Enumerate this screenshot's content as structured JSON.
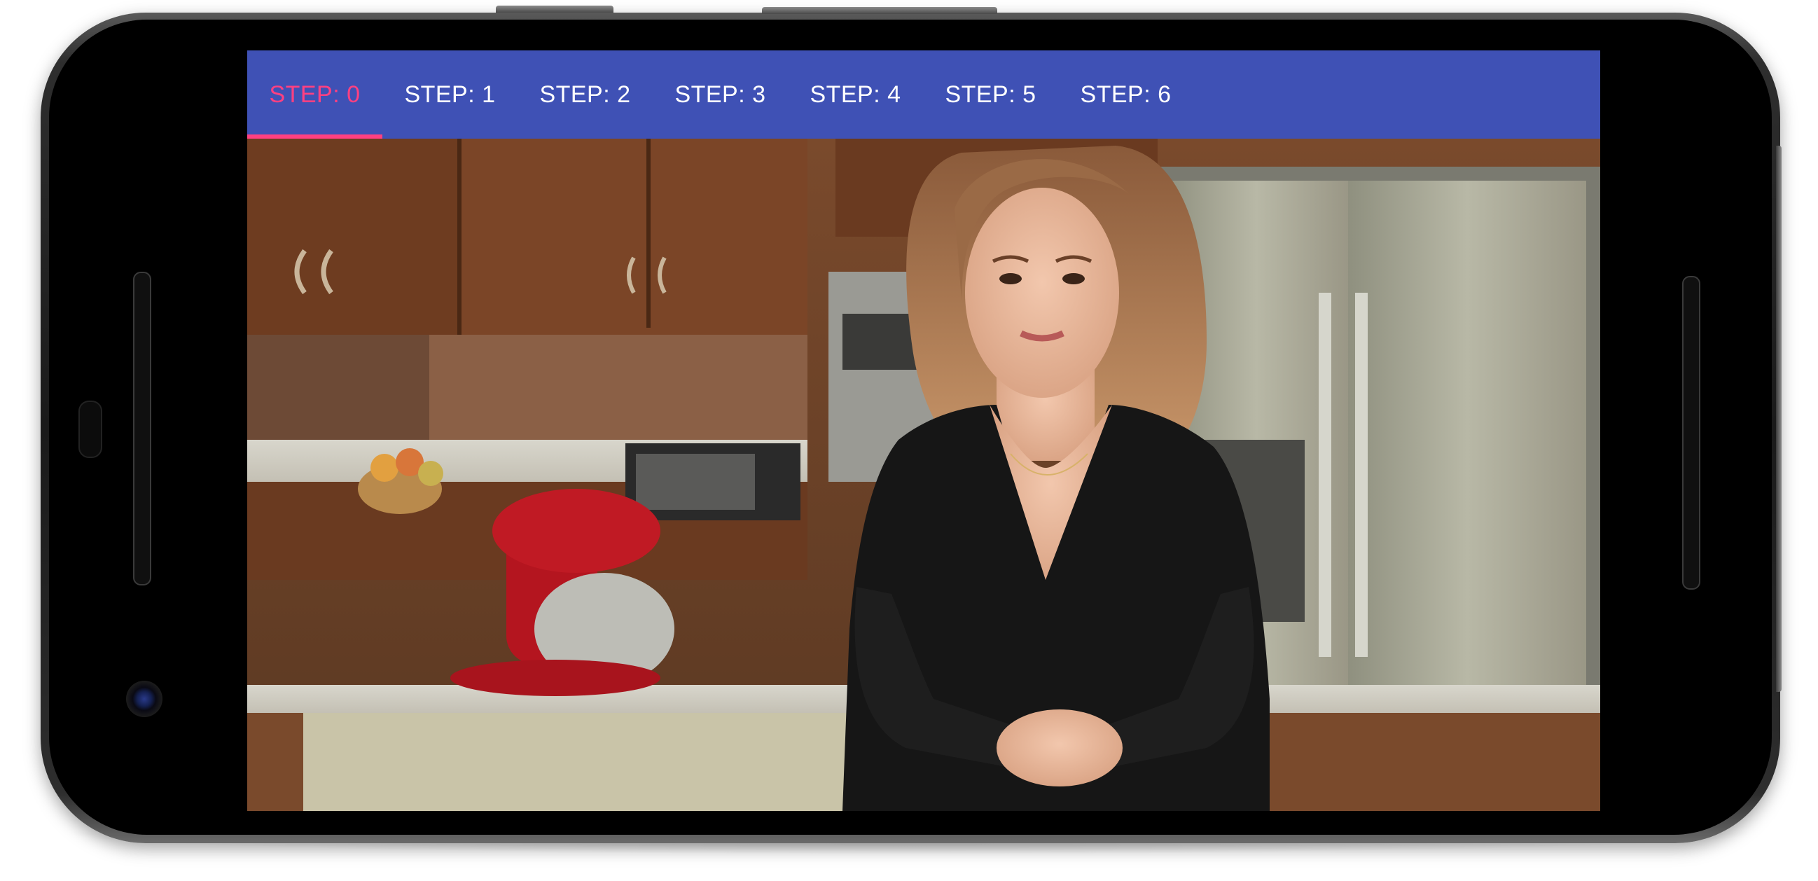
{
  "tabs": [
    {
      "label": "STEP: 0",
      "selected": true
    },
    {
      "label": "STEP: 1",
      "selected": false
    },
    {
      "label": "STEP: 2",
      "selected": false
    },
    {
      "label": "STEP: 3",
      "selected": false
    },
    {
      "label": "STEP: 4",
      "selected": false
    },
    {
      "label": "STEP: 5",
      "selected": false
    },
    {
      "label": "STEP: 6",
      "selected": false
    }
  ],
  "colors": {
    "tab_bar": "#3f51b5",
    "tab_active": "#ff4081",
    "tab_inactive": "#ffffff"
  }
}
